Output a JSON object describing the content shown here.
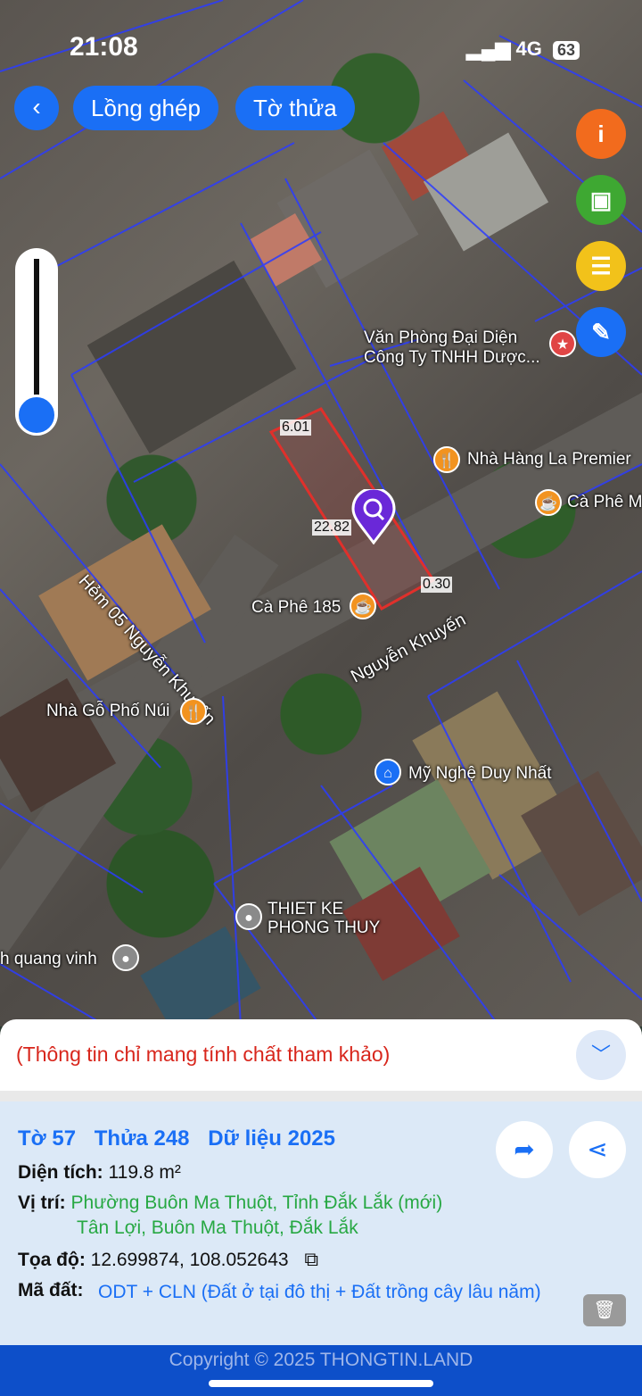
{
  "status": {
    "time": "21:08",
    "network": "4G",
    "battery": "63"
  },
  "topbar": {
    "back_icon": "chevron-left-icon",
    "layer_label": "Lồng ghép",
    "sheet_label": "Tờ thửa"
  },
  "side_buttons": [
    {
      "name": "info-icon",
      "glyph": "i",
      "color": "#f26b1d"
    },
    {
      "name": "save-icon",
      "glyph": "💾",
      "color": "#3ea832"
    },
    {
      "name": "list-icon",
      "glyph": "☰",
      "color": "#f2c21a"
    },
    {
      "name": "edit-icon",
      "glyph": "✎",
      "color": "#1a6ff5"
    }
  ],
  "map": {
    "labels": {
      "office": "Văn Phòng Đại Diện\nCông Ty TNHH Dược...",
      "restaurant": "Nhà Hàng La Premier",
      "cafe_m": "Cà Phê M",
      "alley": "Hẻm 05 Nguyễn Khuyến",
      "cafe185": "Cà Phê 185",
      "street": "Nguyễn Khuyến",
      "wood": "Nhà Gỗ Phố Núi",
      "craft": "Mỹ Nghệ Duy Nhất",
      "fengshui": "THIET KE\nPHONG THUY",
      "quangvinh": "h quang vinh"
    },
    "dimensions": {
      "top": "6.01",
      "left": "22.82",
      "right": "0.30"
    }
  },
  "sheet": {
    "note": "(Thông tin chỉ mang tính chất tham khảo)",
    "collapse_icon": "chevron-down-icon"
  },
  "parcel": {
    "sheet": "Tờ 57",
    "plot": "Thửa 248",
    "data_year": "Dữ liệu 2025",
    "area_label": "Diện tích:",
    "area_value": "119.8 m²",
    "location_label": "Vị trí:",
    "location_new": "Phường Buôn Ma Thuột, Tỉnh Đắk Lắk (mới)",
    "location_old": "Tân Lợi, Buôn Ma Thuột, Đắk Lắk",
    "coords_label": "Tọa độ:",
    "coords_value": "12.699874, 108.052643",
    "landcode_label": "Mã đất:",
    "landcode_value": "ODT + CLN (Đất ở tại đô thị + Đất trồng cây lâu năm)"
  },
  "footer": {
    "copyright": "Copyright © 2025 THONGTIN.LAND"
  }
}
